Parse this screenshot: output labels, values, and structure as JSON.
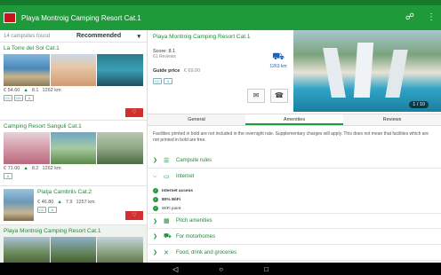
{
  "app": {
    "title": "Playa Montroig Camping Resort Cat.1",
    "brand_color": "#1f9a3b",
    "icons": {
      "share": "share-icon",
      "menu": "more-vert-icon"
    }
  },
  "list": {
    "count_text": "14 campsites found",
    "sort_label": "Recommended",
    "items": [
      {
        "name": "La Torre del Sol Cat.1",
        "price": "€ 54.60",
        "score": "8.1",
        "distance": "1262 km",
        "badges": [
          "CC",
          "DD",
          "A"
        ]
      },
      {
        "name": "Camping Resort Sanguli Cat.1",
        "price": "€ 71.00",
        "score": "8.2",
        "distance": "1262 km",
        "badges": [
          "A"
        ]
      },
      {
        "name": "Platja Cambrils Cat.2",
        "price": "€ 46.80",
        "score": "7.9",
        "distance": "1257 km",
        "badges": [
          "CC",
          "A"
        ]
      },
      {
        "name": "Playa Montroig Camping Resort Cat.1",
        "price": "",
        "score": "",
        "distance": "",
        "badges": []
      }
    ]
  },
  "detail": {
    "title": "Playa Montroig Camping Resort Cat.1",
    "score_label": "Score:",
    "score_value": "8.1",
    "reviews": "61 Reviews",
    "price_label": "Guide price",
    "price_value": "€ 69.00",
    "distance": "1263 km",
    "badges": [
      "CC",
      "A"
    ],
    "photo_counter": "1 / 10",
    "tabs": [
      "General",
      "Amenities",
      "Reviews"
    ],
    "active_tab": "Amenities",
    "note": "Facilities printed in bold are not included in the overnight rate. Supplementary charges will apply. This does not mean that facilities which are not printed in bold are free.",
    "sections": [
      {
        "label": "Campsite rules",
        "expanded": false
      },
      {
        "label": "Internet",
        "expanded": true
      },
      {
        "label": "Pitch amenities",
        "expanded": false
      },
      {
        "label": "For motorhomes",
        "expanded": false
      },
      {
        "label": "Food, drink and groceries",
        "expanded": false
      }
    ],
    "internet_items": [
      {
        "text": "Internet access",
        "bold": true
      },
      {
        "text": "80% WiFi",
        "bold": true
      },
      {
        "text": "WiFi point",
        "bold": false
      }
    ]
  },
  "navbar": {
    "icons": [
      "back-icon",
      "home-icon",
      "recents-icon"
    ]
  }
}
